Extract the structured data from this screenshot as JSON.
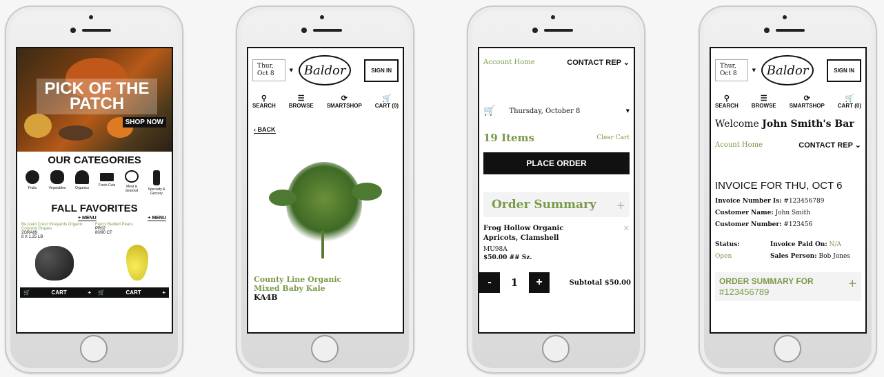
{
  "phone1": {
    "hero_title": "PICK OF THE PATCH",
    "shop_now": "SHOP NOW",
    "categories_heading": "OUR CATEGORIES",
    "categories": [
      "Fruits",
      "Vegetables",
      "Organics",
      "Fresh Cuts",
      "Meat & Seafood",
      "Specialty & Grocery"
    ],
    "favorites_heading": "FALL FAVORITES",
    "menu_label": "+ MENU",
    "products": [
      {
        "name": "Buzzard Crest Vineyards Organic Concord Grapes",
        "code": "2GRA89",
        "size": "8 X 1.25 LB"
      },
      {
        "name": "Fancy Bartlett Pears",
        "code": "PR02",
        "size": "80/90 CT"
      }
    ],
    "cart_label": "CART"
  },
  "phone2": {
    "date": "Thur, Oct 8",
    "logo": "Baldor",
    "sign_in": "SIGN IN",
    "nav": [
      {
        "icon": "search-icon",
        "label": "SEARCH"
      },
      {
        "icon": "menu-icon",
        "label": "BROWSE"
      },
      {
        "icon": "refresh-icon",
        "label": "SMARTSHOP"
      },
      {
        "icon": "cart-icon",
        "label": "CART (0)"
      }
    ],
    "back": "BACK",
    "product_name": "County Line Organic Mixed Baby Kale",
    "product_code": "KA4B"
  },
  "phone3": {
    "account_home": "Account Home",
    "contact_rep": "CONTACT REP",
    "delivery_date": "Thursday, October 8",
    "items_count": "19 Items",
    "clear_cart": "Clear Cart",
    "place_order": "PLACE ORDER",
    "order_summary": "Order Summary",
    "item_name": "Frog Hollow Organic Apricots, Clamshell",
    "item_code": "MU98A",
    "item_price": "$50.00",
    "item_size": "## Sz.",
    "quantity": "1",
    "subtotal": "Subtotal $50.00"
  },
  "phone4": {
    "date": "Thur, Oct 8",
    "logo": "Baldor",
    "sign_in": "SIGN IN",
    "nav": [
      {
        "icon": "search-icon",
        "label": "SEARCH"
      },
      {
        "icon": "menu-icon",
        "label": "BROWSE"
      },
      {
        "icon": "refresh-icon",
        "label": "SMARTSHOP"
      },
      {
        "icon": "cart-icon",
        "label": "CART (0)"
      }
    ],
    "welcome_prefix": "Welcome",
    "welcome_name": "John Smith's Bar",
    "account_home": "Acount Home",
    "contact_rep": "CONTACT REP",
    "invoice_title": "INVOICE FOR THU, OCT 6",
    "invoice_number_label": "Invoice Number Is:",
    "invoice_number": "#123456789",
    "customer_name_label": "Customer Name:",
    "customer_name": "John Smith",
    "customer_number_label": "Customer Number:",
    "customer_number": "#123456",
    "status_label": "Status:",
    "status_value": "Open",
    "paid_on_label": "Invoice Paid On:",
    "paid_on_value": "N/A",
    "sales_person_label": "Sales Person:",
    "sales_person_value": "Bob Jones",
    "order_summary_for": "ORDER SUMMARY FOR",
    "order_number": "#123456789"
  }
}
